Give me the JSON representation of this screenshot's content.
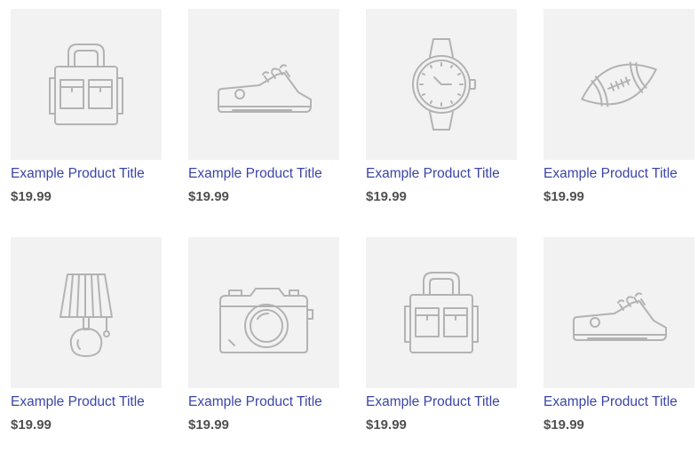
{
  "products": [
    {
      "icon": "bag-icon",
      "title": "Example Product Title",
      "price": "$19.99"
    },
    {
      "icon": "sneaker-icon",
      "title": "Example Product Title",
      "price": "$19.99"
    },
    {
      "icon": "watch-icon",
      "title": "Example Product Title",
      "price": "$19.99"
    },
    {
      "icon": "football-icon",
      "title": "Example Product Title",
      "price": "$19.99"
    },
    {
      "icon": "lamp-icon",
      "title": "Example Product Title",
      "price": "$19.99"
    },
    {
      "icon": "camera-icon",
      "title": "Example Product Title",
      "price": "$19.99"
    },
    {
      "icon": "bag-icon",
      "title": "Example Product Title",
      "price": "$19.99"
    },
    {
      "icon": "sneaker-icon",
      "title": "Example Product Title",
      "price": "$19.99"
    }
  ],
  "colors": {
    "thumb_bg": "#f2f2f2",
    "icon_stroke": "#b3b3b3",
    "title": "#3b45a6",
    "price": "#505050"
  }
}
